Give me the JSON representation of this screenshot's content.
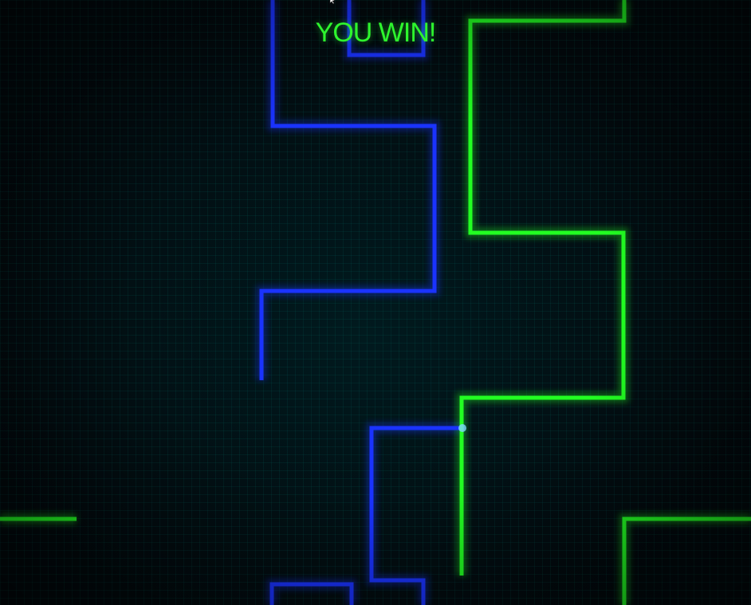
{
  "game": {
    "status_message": "YOU WIN!",
    "colors": {
      "player_trail": "#1a33ff",
      "opponent_trail": "#22ff22",
      "status_text": "#2ef52e",
      "grid_line": "#00786e",
      "background": "#02090d"
    }
  },
  "icons": {
    "cursor": "mouse-pointer-icon"
  }
}
